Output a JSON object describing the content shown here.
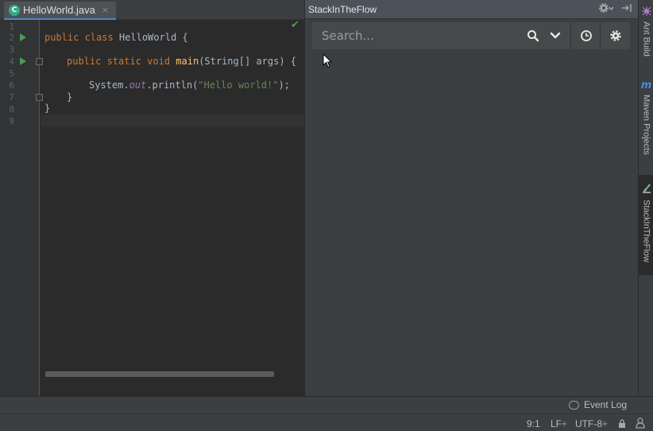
{
  "editor": {
    "tab": {
      "icon": "java-class-icon",
      "icon_letter": "C",
      "name": "HelloWorld.java",
      "close": "×"
    },
    "line_numbers": [
      "1",
      "2",
      "3",
      "4",
      "5",
      "6",
      "7",
      "8",
      "9"
    ],
    "code": {
      "l2": {
        "kw": "public class ",
        "name": "HelloWorld {"
      },
      "l4": {
        "kw": "public static void ",
        "fn": "main",
        "rest": "(String[] args) {"
      },
      "l6": {
        "a": "System.",
        "b": "out",
        "c": ".println(",
        "d": "\"Hello world!\"",
        "e": ");"
      },
      "l7": "}",
      "l8": "}"
    },
    "check": "✔"
  },
  "toolwindow": {
    "title": "StackInTheFlow",
    "search_placeholder": "Search...",
    "icons": [
      "search-icon",
      "chevron-down-icon",
      "history-icon",
      "gear-icon"
    ]
  },
  "right_strip": {
    "tabs": [
      "Ant Build",
      "Maven Projects",
      "StackInTheFlow"
    ],
    "maven_icon_text": "m"
  },
  "event_log": "Event Log",
  "status": {
    "position": "9:1",
    "line_sep": "LF÷",
    "encoding": "UTF-8÷"
  }
}
